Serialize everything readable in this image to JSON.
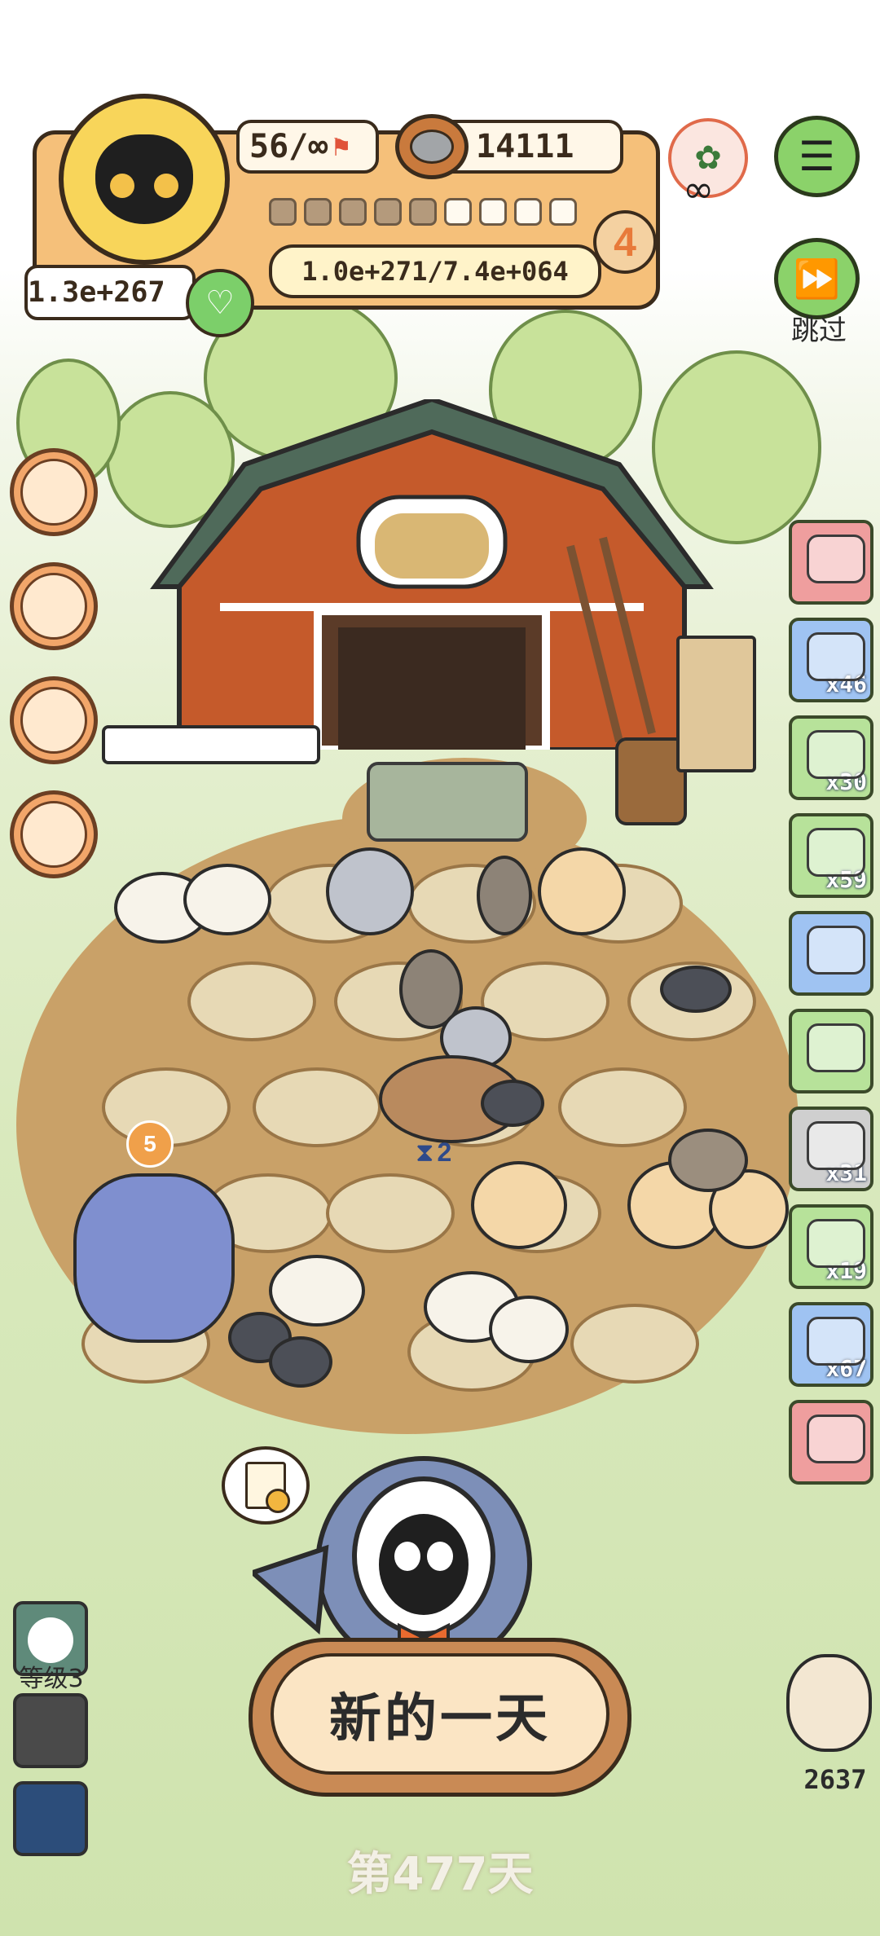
{
  "hud": {
    "capacity": "56/∞",
    "coins": "14111",
    "level_badge": "4",
    "progress_filled": 5,
    "progress_total": 9,
    "exp_text": "1.0e+271/7.4e+064",
    "power": "1.3e+267"
  },
  "buttons": {
    "skip_label": "跳过",
    "new_day_label": "新的一天",
    "day_text": "第477天"
  },
  "side_items": [
    {
      "color": "#ef9e9e",
      "count": ""
    },
    {
      "color": "#9fc3f2",
      "count": "x46"
    },
    {
      "color": "#b7e29a",
      "count": "x30"
    },
    {
      "color": "#b7e29a",
      "count": "x59"
    },
    {
      "color": "#9fc3f2",
      "count": ""
    },
    {
      "color": "#b7e29a",
      "count": ""
    },
    {
      "color": "#cfcfcf",
      "count": "x31"
    },
    {
      "color": "#b7e29a",
      "count": "x19"
    },
    {
      "color": "#9fc3f2",
      "count": "x67"
    },
    {
      "color": "#ef9e9e",
      "count": ""
    }
  ],
  "level_label": "等级3",
  "owl_count": "2637",
  "timer_text": "2",
  "dragon_badge": "5"
}
